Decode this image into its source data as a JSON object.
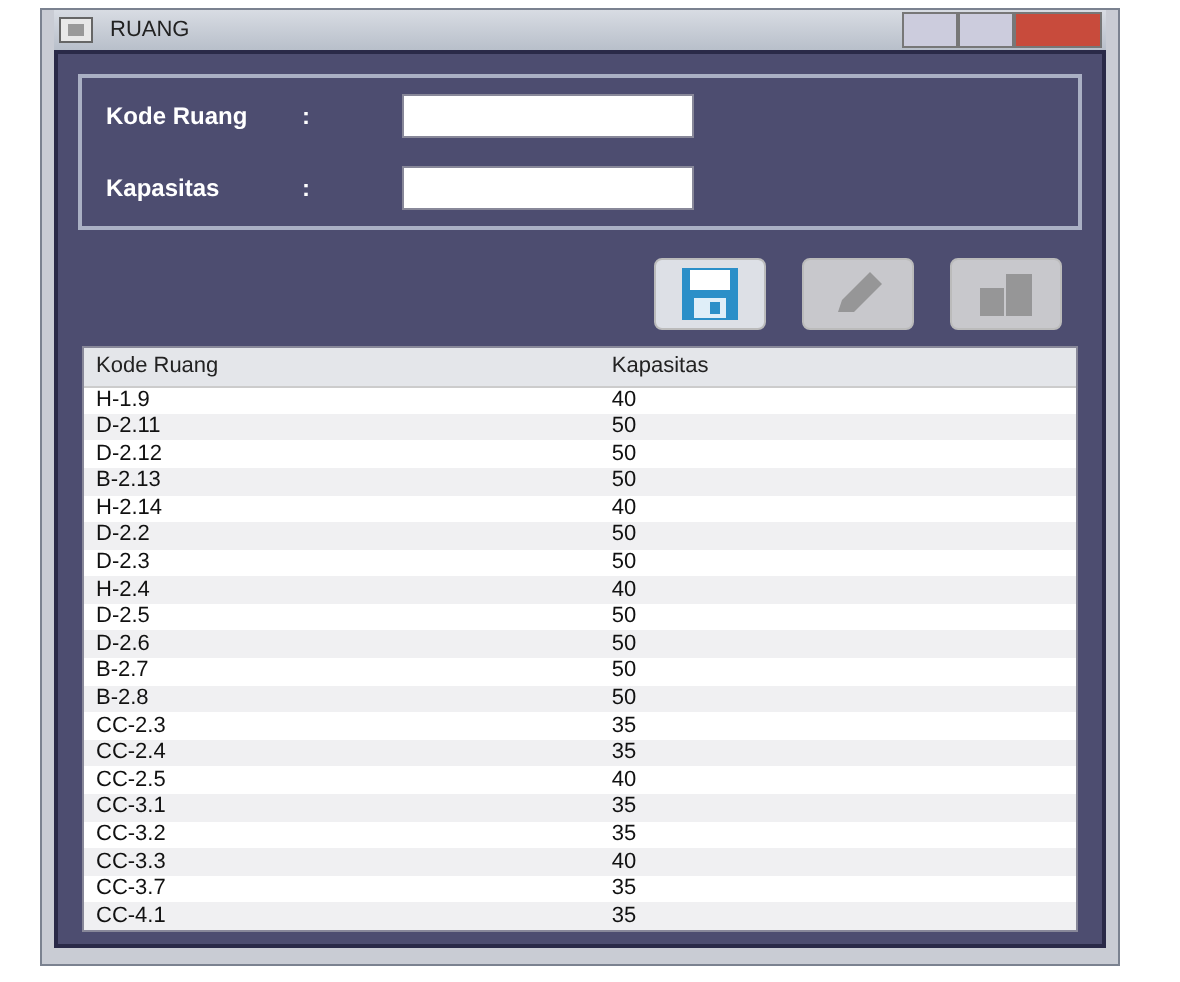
{
  "window": {
    "title": "RUANG"
  },
  "form": {
    "fields": [
      {
        "label": "Kode Ruang",
        "colon": ":"
      },
      {
        "label": "Kapasitas",
        "colon": ":"
      }
    ]
  },
  "toolbar": [
    {
      "kind": "save",
      "disabled": false
    },
    {
      "kind": "edit",
      "disabled": true
    },
    {
      "kind": "delete",
      "disabled": true
    }
  ],
  "table": {
    "columns": [
      "Kode Ruang",
      "Kapasitas"
    ],
    "rows": [
      [
        "H-1.9",
        "40"
      ],
      [
        "D-2.11",
        "50"
      ],
      [
        "D-2.12",
        "50"
      ],
      [
        "B-2.13",
        "50"
      ],
      [
        "H-2.14",
        "40"
      ],
      [
        "D-2.2",
        "50"
      ],
      [
        "D-2.3",
        "50"
      ],
      [
        "H-2.4",
        "40"
      ],
      [
        "D-2.5",
        "50"
      ],
      [
        "D-2.6",
        "50"
      ],
      [
        "B-2.7",
        "50"
      ],
      [
        "B-2.8",
        "50"
      ],
      [
        "CC-2.3",
        "35"
      ],
      [
        "CC-2.4",
        "35"
      ],
      [
        "CC-2.5",
        "40"
      ],
      [
        "CC-3.1",
        "35"
      ],
      [
        "CC-3.2",
        "35"
      ],
      [
        "CC-3.3",
        "40"
      ],
      [
        "CC-3.7",
        "35"
      ],
      [
        "CC-4.1",
        "35"
      ]
    ]
  }
}
